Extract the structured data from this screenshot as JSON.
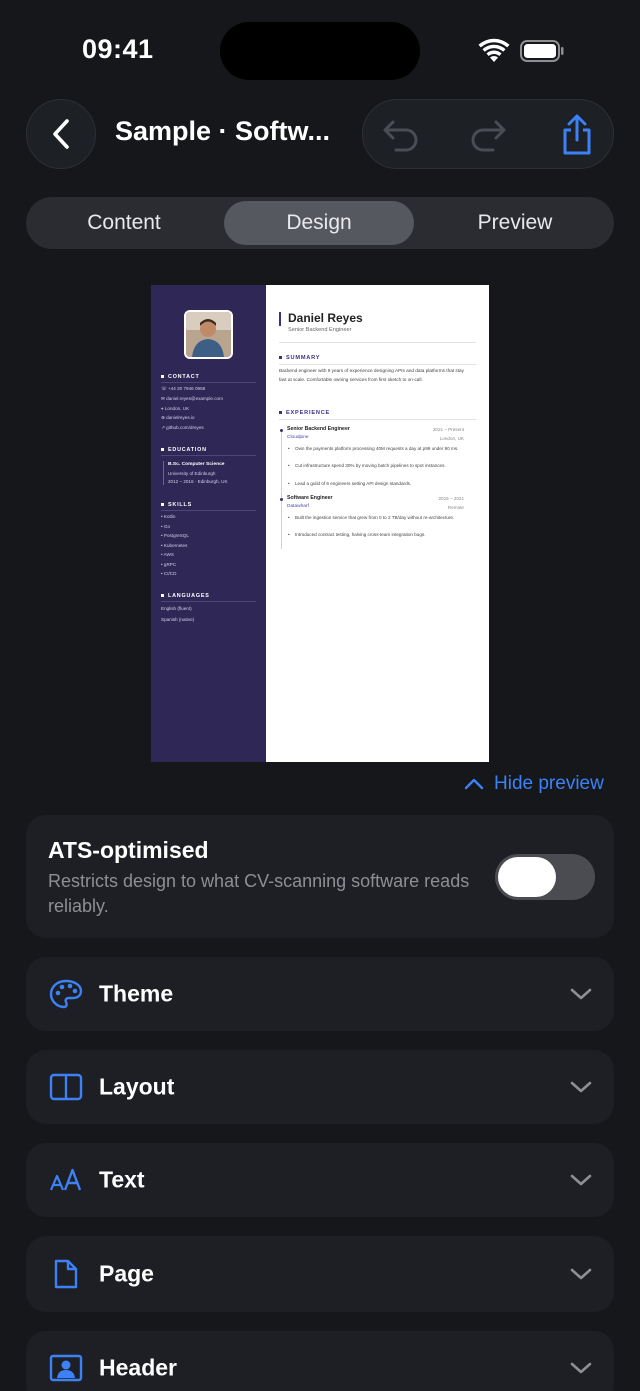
{
  "status_bar": {
    "time": "09:41"
  },
  "nav": {
    "title": "Sample · Softw..."
  },
  "tabs": [
    {
      "label": "Content",
      "active": false
    },
    {
      "label": "Design",
      "active": true
    },
    {
      "label": "Preview",
      "active": false
    }
  ],
  "cv": {
    "name": "Daniel Reyes",
    "role": "Senior Backend Engineer",
    "sidebar": {
      "contact_heading": "CONTACT",
      "contact": [
        "+44 20 7946 0958",
        "daniel.reyes@example.com",
        "London, UK",
        "danielreyes.io",
        "github.com/dreyes"
      ],
      "education_heading": "EDUCATION",
      "degree": "B.Sc. Computer Science",
      "school": "University of Edinburgh",
      "edu_dates": "2012 – 2016 · Edinburgh, UK",
      "skills_heading": "SKILLS",
      "skills": [
        "Kotlin",
        "Go",
        "PostgreSQL",
        "Kubernetes",
        "AWS",
        "gRPC",
        "CI/CD"
      ],
      "languages_heading": "LANGUAGES",
      "languages": [
        "English (fluent)",
        "Spanish (native)"
      ]
    },
    "summary_heading": "SUMMARY",
    "summary": "Backend engineer with 9 years of experience designing APIs and data platforms that stay fast at scale. Comfortable owning services from first sketch to on-call.",
    "experience_heading": "EXPERIENCE",
    "jobs": [
      {
        "title": "Senior Backend Engineer",
        "dates": "2021 – Present",
        "company": "Cloudpine",
        "location": "London, UK",
        "bullets": [
          "Own the payments platform processing 40M requests a day at p99 under 80 ms.",
          "Cut infrastructure spend 30% by moving batch pipelines to spot instances.",
          "Lead a guild of 6 engineers setting API design standards."
        ]
      },
      {
        "title": "Software Engineer",
        "dates": "2016 – 2021",
        "company": "Datawharf",
        "location": "Remote",
        "bullets": [
          "Built the ingestion service that grew from 0 to 2 TB/day without re-architecture.",
          "Introduced contract testing, halving cross-team integration bugs."
        ]
      }
    ]
  },
  "hide_preview_label": "Hide preview",
  "ats": {
    "title": "ATS-optimised",
    "description": "Restricts design to what CV-scanning software reads reliably.",
    "enabled": false
  },
  "sections": [
    {
      "label": "Theme",
      "icon": "palette-icon"
    },
    {
      "label": "Layout",
      "icon": "columns-icon"
    },
    {
      "label": "Text",
      "icon": "text-size-icon"
    },
    {
      "label": "Page",
      "icon": "page-icon"
    },
    {
      "label": "Header",
      "icon": "person-card-icon"
    }
  ],
  "colors": {
    "accent": "#3c82f6",
    "cv_sidebar": "#2f2856",
    "cv_accent": "#3b2f86",
    "background": "#15171b",
    "card": "#1d1f24"
  }
}
